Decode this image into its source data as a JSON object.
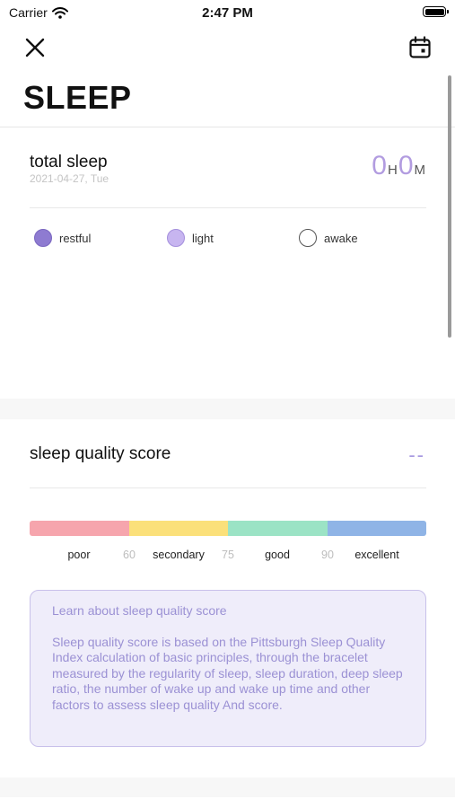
{
  "status_bar": {
    "carrier": "Carrier",
    "time": "2:47 PM"
  },
  "nav": {
    "close_icon": "close-icon",
    "calendar_icon": "calendar-icon"
  },
  "page": {
    "title": "SLEEP"
  },
  "total_sleep": {
    "label": "total sleep",
    "date": "2021-04-27, Tue",
    "hours": "0",
    "hours_unit": "H",
    "minutes": "0",
    "minutes_unit": "M"
  },
  "legend": [
    {
      "label": "restful",
      "color": "#8e7bd1"
    },
    {
      "label": "light",
      "color": "#c7b5f0"
    },
    {
      "label": "awake",
      "color": "#ffffff"
    }
  ],
  "quality": {
    "title": "sleep quality score",
    "score": "--",
    "segments": [
      {
        "color": "#f6a5ad"
      },
      {
        "color": "#fbe07a"
      },
      {
        "color": "#9be3c5"
      },
      {
        "color": "#8fb4e6"
      }
    ],
    "categories": [
      "poor",
      "secondary",
      "good",
      "excellent"
    ],
    "thresholds": [
      "60",
      "75",
      "90"
    ]
  },
  "info": {
    "title": "Learn about sleep quality score",
    "text": "Sleep quality score is based on the Pittsburgh Sleep Quality Index calculation of basic principles, through the bracelet measured by the regularity of sleep, sleep duration, deep sleep ratio, the number of wake up and wake up time and other factors to assess sleep quality And score."
  }
}
